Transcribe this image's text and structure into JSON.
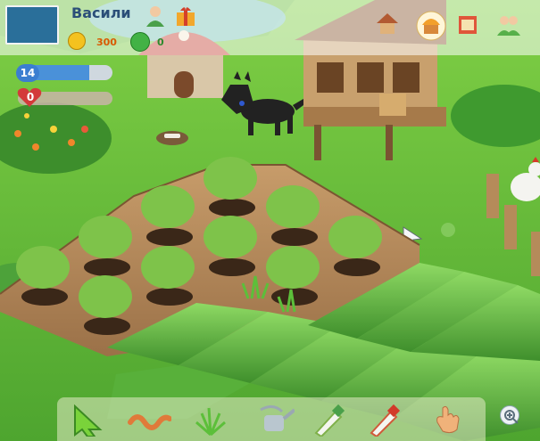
{
  "player": {
    "name": "Васили"
  },
  "currency": {
    "coins": "300",
    "dollars": "0"
  },
  "level": {
    "value": "14",
    "progress": 0.75
  },
  "hearts": {
    "value": "0",
    "progress": 0
  },
  "top_icons": [
    "profile-icon",
    "gift-icon",
    "farmhouse-icon",
    "cupcake-shop-icon",
    "market-icon",
    "friends-icon"
  ],
  "toolbar": {
    "tools": [
      {
        "name": "select-arrow-tool-icon"
      },
      {
        "name": "worm-fertilizer-tool-icon"
      },
      {
        "name": "plant-seeds-tool-icon"
      },
      {
        "name": "watering-can-tool-icon"
      },
      {
        "name": "green-spray-tool-icon"
      },
      {
        "name": "red-spray-tool-icon"
      },
      {
        "name": "hand-harvest-tool-icon"
      }
    ],
    "zoom_icon": "zoom-in-icon"
  },
  "colors": {
    "grass": "#5fb53a",
    "soil": "#6b4a2c",
    "cabbage": "#4fa43a",
    "hud_text": "#2b4f78",
    "coin_text": "#d95a00"
  }
}
